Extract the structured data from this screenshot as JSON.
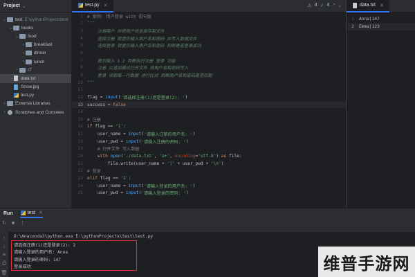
{
  "project": {
    "title": "Project",
    "items": [
      {
        "label": "test",
        "path": "E:\\pythonProjects\\test",
        "icon": "folder-icon",
        "depth": 0,
        "expanded": true
      },
      {
        "label": "books",
        "depth": 1,
        "icon": "folder-icon",
        "expanded": true
      },
      {
        "label": "food",
        "depth": 2,
        "icon": "folder-icon",
        "expanded": true
      },
      {
        "label": "breakfast",
        "depth": 3,
        "icon": "folder-icon",
        "expanded": false
      },
      {
        "label": "dinner",
        "depth": 3,
        "icon": "folder-icon",
        "expanded": false
      },
      {
        "label": "lunch",
        "depth": 3,
        "icon": "folder-icon",
        "expanded": false
      },
      {
        "label": "IT",
        "depth": 2,
        "icon": "folder-icon",
        "expanded": false
      },
      {
        "label": "data.txt",
        "depth": 1,
        "icon": "text-file-icon",
        "selected": true
      },
      {
        "label": "Snow.jpg",
        "depth": 1,
        "icon": "image-file-icon"
      },
      {
        "label": "test.py",
        "depth": 1,
        "icon": "python-file-icon"
      },
      {
        "label": "External Libraries",
        "depth": 0,
        "icon": "library-icon",
        "expanded": false
      },
      {
        "label": "Scratches and Consoles",
        "depth": 0,
        "icon": "scratch-icon",
        "expanded": false
      }
    ]
  },
  "editor": {
    "tab_label": "test.py",
    "inspection": {
      "warnings": "4",
      "checks": "4"
    }
  },
  "data_pane": {
    "tab_label": "data.txt",
    "lines": [
      "Anna|147",
      "Emma|123"
    ]
  },
  "run": {
    "title": "Run",
    "tab_label": "test",
    "console": [
      "D:\\Anaconda3\\python.exe E:\\pythonProjects\\test\\test.py",
      "请选择注册(1)还是登录(2): 2",
      "请输入登录的用户名: Anna",
      "请输入登录的密码: 147",
      "登录成功"
    ]
  },
  "watermark": "维普手游网",
  "colors": {
    "accent": "#3574f0",
    "highlight_box": "#e0303a",
    "string": "#6aab73",
    "keyword": "#cf8e6d"
  }
}
